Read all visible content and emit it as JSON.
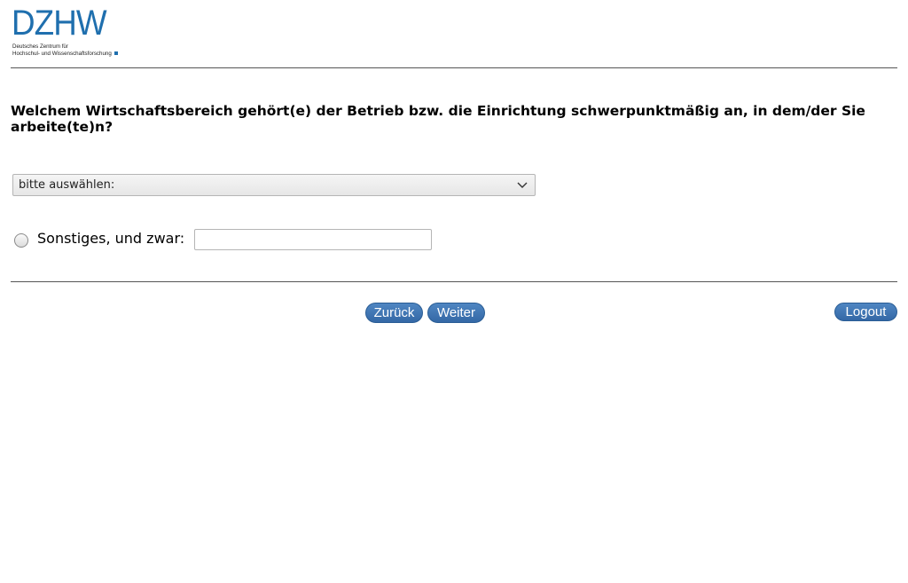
{
  "logo": {
    "main": "DZHW",
    "line1": "Deutsches Zentrum für",
    "line2": "Hochschul- und Wissenschaftsforschung"
  },
  "question": {
    "text": "Welchem Wirtschaftsbereich gehört(e) der Betrieb bzw. die Einrichtung schwerpunktmäßig an, in dem/der Sie arbeite(te)n?"
  },
  "select": {
    "value": "bitte auswählen:"
  },
  "other": {
    "label": "Sonstiges, und zwar:",
    "value": ""
  },
  "nav": {
    "back_label": "Zurück",
    "next_label": "Weiter",
    "logout_label": "Logout"
  },
  "colors": {
    "brand": "#1f6fae",
    "button": "#3a6fb0"
  }
}
